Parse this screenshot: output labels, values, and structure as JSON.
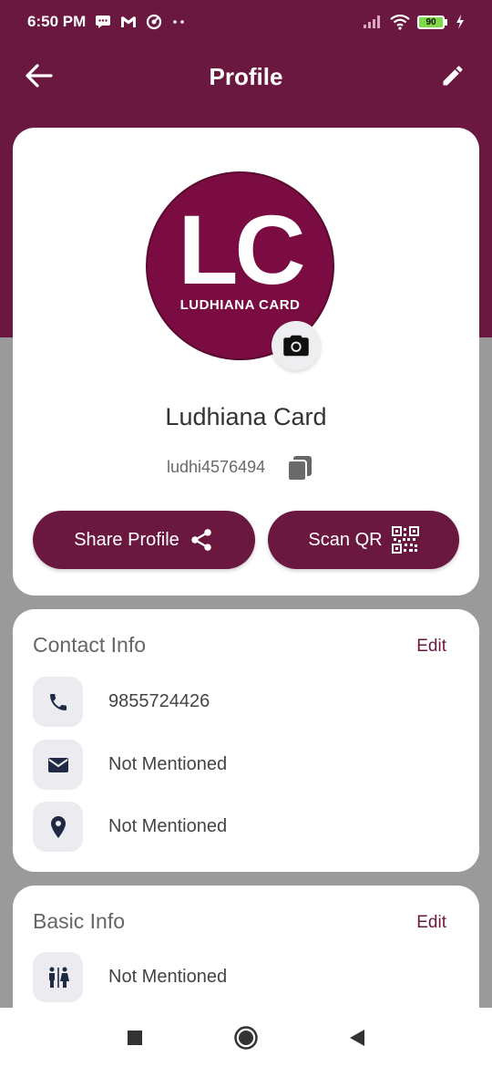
{
  "status_bar": {
    "time": "6:50 PM",
    "battery": "90"
  },
  "app_bar": {
    "title": "Profile"
  },
  "profile": {
    "logo_letters": "LC",
    "logo_subtitle": "LUDHIANA CARD",
    "name": "Ludhiana Card",
    "user_id": "ludhi4576494",
    "share_button": "Share Profile",
    "scan_button": "Scan QR"
  },
  "contact_info": {
    "title": "Contact Info",
    "edit_label": "Edit",
    "phone": "9855724426",
    "email": "Not Mentioned",
    "location": "Not Mentioned"
  },
  "basic_info": {
    "title": "Basic Info",
    "edit_label": "Edit",
    "gender": "Not Mentioned"
  },
  "colors": {
    "brand": "#6b1840",
    "logo": "#7a0c42",
    "icon_bg": "#ececf0",
    "page_bg": "#9a9a9a"
  }
}
